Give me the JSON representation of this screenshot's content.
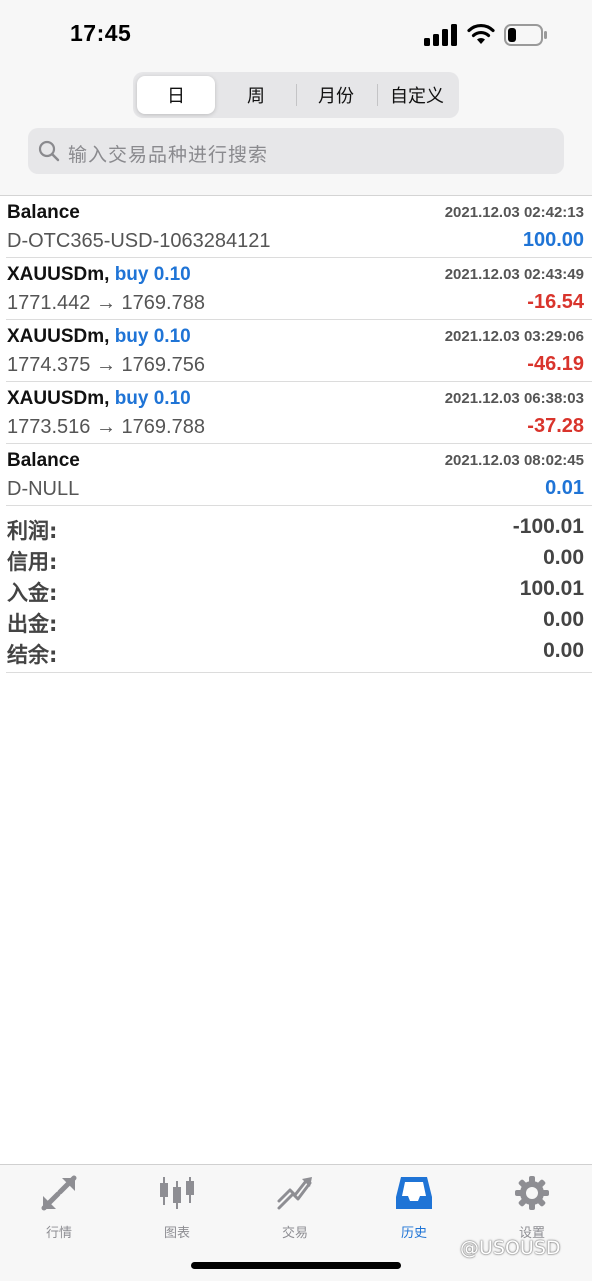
{
  "status_bar": {
    "time": "17:45"
  },
  "period_tabs": [
    {
      "label": "日",
      "active": true
    },
    {
      "label": "周",
      "active": false
    },
    {
      "label": "月份",
      "active": false
    },
    {
      "label": "自定义",
      "active": false
    }
  ],
  "search": {
    "placeholder": "输入交易品种进行搜索"
  },
  "records": [
    {
      "title": "Balance",
      "type": "",
      "date": "2021.12.03 02:42:13",
      "sub": "D-OTC365-USD-1063284121",
      "amount": "100.00",
      "sign": "pos"
    },
    {
      "title": "XAUUSDm,",
      "type": "buy 0.10",
      "date": "2021.12.03 02:43:49",
      "sub": "1771.442 → 1769.788",
      "amount": "-16.54",
      "sign": "neg"
    },
    {
      "title": "XAUUSDm,",
      "type": "buy 0.10",
      "date": "2021.12.03 03:29:06",
      "sub": "1774.375 → 1769.756",
      "amount": "-46.19",
      "sign": "neg"
    },
    {
      "title": "XAUUSDm,",
      "type": "buy 0.10",
      "date": "2021.12.03 06:38:03",
      "sub": "1773.516 → 1769.788",
      "amount": "-37.28",
      "sign": "neg"
    },
    {
      "title": "Balance",
      "type": "",
      "date": "2021.12.03 08:02:45",
      "sub": "D-NULL",
      "amount": "0.01",
      "sign": "pos"
    }
  ],
  "summary": [
    {
      "label": "利润:",
      "value": "-100.01"
    },
    {
      "label": "信用:",
      "value": "0.00"
    },
    {
      "label": "入金:",
      "value": "100.01"
    },
    {
      "label": "出金:",
      "value": "0.00"
    },
    {
      "label": "结余:",
      "value": "0.00"
    }
  ],
  "tabbar": [
    {
      "label": "行情",
      "icon": "quotes-icon",
      "active": false
    },
    {
      "label": "图表",
      "icon": "chart-icon",
      "active": false
    },
    {
      "label": "交易",
      "icon": "trade-icon",
      "active": false
    },
    {
      "label": "历史",
      "icon": "history-icon",
      "active": true
    },
    {
      "label": "设置",
      "icon": "settings-icon",
      "active": false
    }
  ],
  "watermark": "@USOUSD",
  "colors": {
    "accent": "#1f74d6",
    "negative": "#d9342c"
  }
}
